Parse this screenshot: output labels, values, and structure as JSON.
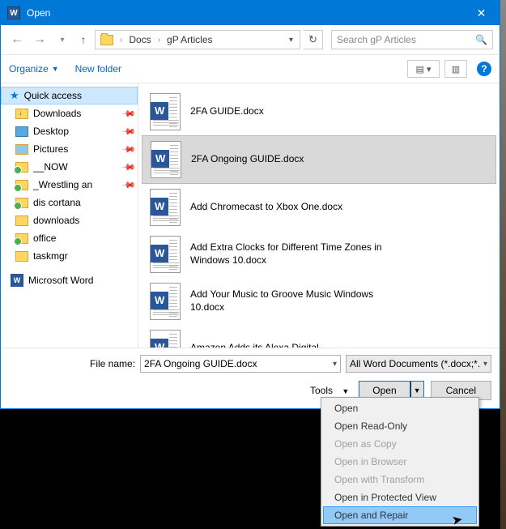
{
  "window": {
    "title": "Open"
  },
  "nav": {
    "path": [
      "Docs",
      "gP Articles"
    ],
    "search_placeholder": "Search gP Articles"
  },
  "toolbar": {
    "organize": "Organize",
    "newfolder": "New folder"
  },
  "sidebar": {
    "quick_access": "Quick access",
    "items": [
      {
        "label": "Downloads",
        "pinned": true,
        "icon": "dl"
      },
      {
        "label": "Desktop",
        "pinned": true,
        "icon": "desk"
      },
      {
        "label": "Pictures",
        "pinned": true,
        "icon": "pic"
      },
      {
        "label": "__NOW",
        "pinned": true,
        "icon": "green"
      },
      {
        "label": "_Wrestling an",
        "pinned": true,
        "icon": "green"
      },
      {
        "label": "dis cortana",
        "pinned": false,
        "icon": "green"
      },
      {
        "label": "downloads",
        "pinned": false,
        "icon": "plain"
      },
      {
        "label": "office",
        "pinned": false,
        "icon": "green"
      },
      {
        "label": "taskmgr",
        "pinned": false,
        "icon": "plain"
      }
    ],
    "word": "Microsoft Word"
  },
  "files": [
    {
      "name": "2FA GUIDE.docx",
      "selected": false
    },
    {
      "name": "2FA Ongoing GUIDE.docx",
      "selected": true
    },
    {
      "name": "Add Chromecast to Xbox One.docx",
      "selected": false
    },
    {
      "name": "Add Extra Clocks for Different Time Zones in Windows 10.docx",
      "selected": false
    },
    {
      "name": "Add Your Music to Groove Music Windows 10.docx",
      "selected": false
    },
    {
      "name": "Amazon Adds its Alexa Digital",
      "selected": false
    }
  ],
  "footer": {
    "filename_label": "File name:",
    "filename_value": "2FA Ongoing GUIDE.docx",
    "filter": "All Word Documents (*.docx;*.",
    "tools": "Tools",
    "open": "Open",
    "cancel": "Cancel"
  },
  "dropdown": {
    "items": [
      {
        "label": "Open",
        "enabled": true
      },
      {
        "label": "Open Read-Only",
        "enabled": true
      },
      {
        "label": "Open as Copy",
        "enabled": false
      },
      {
        "label": "Open in Browser",
        "enabled": false
      },
      {
        "label": "Open with Transform",
        "enabled": false
      },
      {
        "label": "Open in Protected View",
        "enabled": true
      },
      {
        "label": "Open and Repair",
        "enabled": true,
        "hover": true
      }
    ]
  }
}
